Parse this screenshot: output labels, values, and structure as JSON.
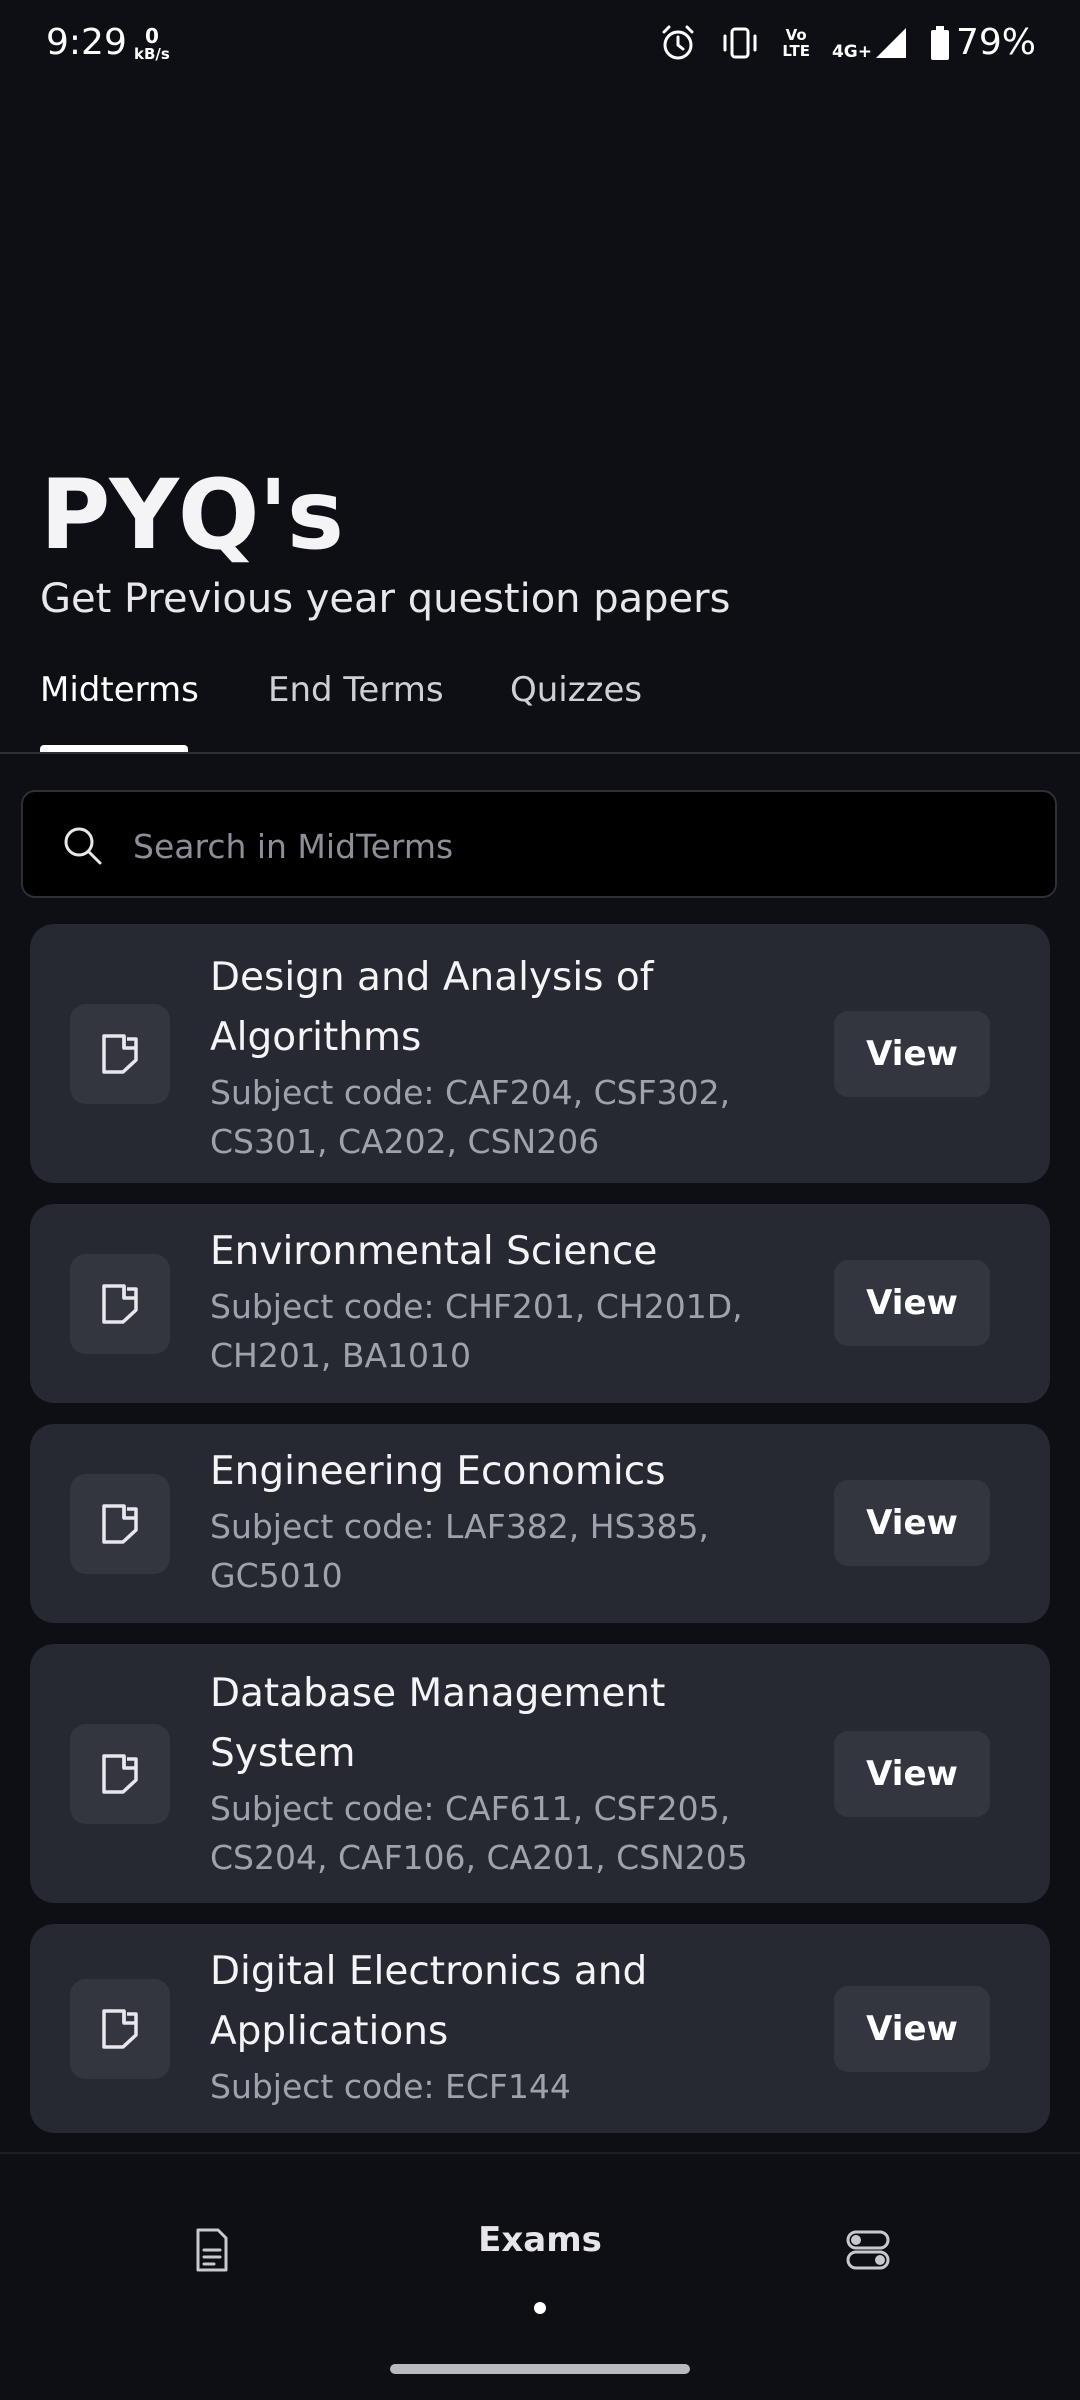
{
  "status_bar": {
    "time": "9:29",
    "speed_value": "0",
    "speed_unit": "kB/s",
    "volte_line1": "Vo",
    "volte_line2": "LTE",
    "network": "4G+",
    "battery": "79%"
  },
  "header": {
    "title": "PYQ's",
    "subtitle": "Get Previous year question papers"
  },
  "tabs": [
    {
      "label": "Midterms",
      "active": true
    },
    {
      "label": "End Terms",
      "active": false
    },
    {
      "label": "Quizzes",
      "active": false
    }
  ],
  "search": {
    "placeholder": "Search in MidTerms",
    "value": ""
  },
  "subjects": [
    {
      "title_line1": "Design and Analysis of",
      "title_line2": "Algorithms",
      "code_line1": "Subject code: CAF204, CSF302,",
      "code_line2": "CS301, CA202, CSN206",
      "action": "View"
    },
    {
      "title_line1": "Environmental Science",
      "title_line2": "",
      "code_line1": "Subject code: CHF201, CH201D,",
      "code_line2": "CH201, BA1010",
      "action": "View"
    },
    {
      "title_line1": "Engineering Economics",
      "title_line2": "",
      "code_line1": "Subject code: LAF382, HS385,",
      "code_line2": "GC5010",
      "action": "View"
    },
    {
      "title_line1": "Database Management",
      "title_line2": "System",
      "code_line1": "Subject code: CAF611, CSF205,",
      "code_line2": "CS204, CAF106, CA201, CSN205",
      "action": "View"
    },
    {
      "title_line1": "Digital Electronics and",
      "title_line2": "Applications",
      "code_line1": "Subject code: ECF144",
      "code_line2": "",
      "action": "View"
    }
  ],
  "bottom_nav": {
    "left_icon": "document-icon",
    "center_label": "Exams",
    "right_icon": "toggles-icon"
  },
  "colors": {
    "background": "#0d0f14",
    "card": "#262832",
    "button": "#33353f",
    "muted_text": "#a0a2ab"
  }
}
